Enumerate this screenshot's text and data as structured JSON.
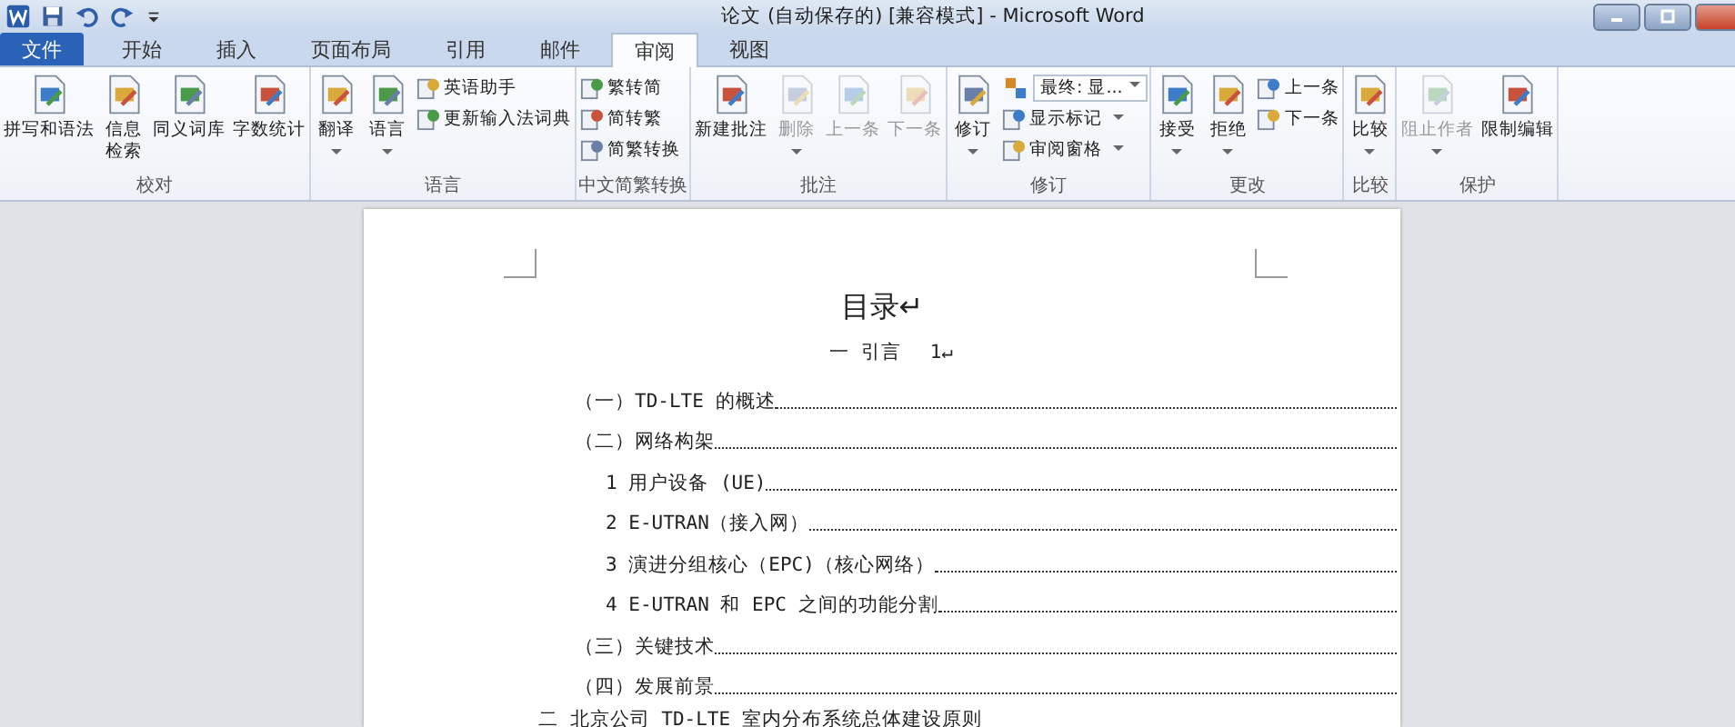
{
  "window": {
    "title": "论文 (自动保存的) [兼容模式] - Microsoft Word"
  },
  "tabs": [
    {
      "label": "文件",
      "kind": "file",
      "selected": false
    },
    {
      "label": "开始",
      "kind": "tab",
      "selected": false
    },
    {
      "label": "插入",
      "kind": "tab",
      "selected": false
    },
    {
      "label": "页面布局",
      "kind": "tab",
      "selected": false
    },
    {
      "label": "引用",
      "kind": "tab",
      "selected": false
    },
    {
      "label": "邮件",
      "kind": "tab",
      "selected": false
    },
    {
      "label": "审阅",
      "kind": "tab",
      "selected": true
    },
    {
      "label": "视图",
      "kind": "tab",
      "selected": false
    }
  ],
  "ribbon": {
    "groups": [
      {
        "label": "校对",
        "controls": [
          {
            "kind": "large",
            "label": "拼写和语法",
            "disabled": false,
            "has_menu": false
          },
          {
            "kind": "large",
            "label": "信息检索",
            "wrap": true,
            "disabled": false,
            "has_menu": false
          },
          {
            "kind": "large",
            "label": "同义词库",
            "disabled": false,
            "has_menu": false
          },
          {
            "kind": "large",
            "label": "字数统计",
            "disabled": false,
            "has_menu": false
          }
        ]
      },
      {
        "label": "语言",
        "controls": [
          {
            "kind": "large",
            "label": "翻译",
            "disabled": false,
            "has_menu": true
          },
          {
            "kind": "large",
            "label": "语言",
            "disabled": false,
            "has_menu": true
          },
          {
            "kind": "stack",
            "items": [
              {
                "kind": "small",
                "label": "英语助手",
                "disabled": false,
                "has_menu": false
              },
              {
                "kind": "small",
                "label": "更新输入法词典",
                "disabled": false,
                "has_menu": false
              }
            ]
          }
        ]
      },
      {
        "label": "中文简繁转换",
        "controls": [
          {
            "kind": "stack",
            "items": [
              {
                "kind": "small",
                "label": "繁转简",
                "disabled": false,
                "has_menu": false
              },
              {
                "kind": "small",
                "label": "简转繁",
                "disabled": false,
                "has_menu": false
              },
              {
                "kind": "small",
                "label": "简繁转换",
                "disabled": false,
                "has_menu": false
              }
            ]
          }
        ]
      },
      {
        "label": "批注",
        "controls": [
          {
            "kind": "large",
            "label": "新建批注",
            "disabled": false,
            "has_menu": false
          },
          {
            "kind": "large",
            "label": "删除",
            "disabled": true,
            "has_menu": true
          },
          {
            "kind": "large",
            "label": "上一条",
            "disabled": true,
            "has_menu": false
          },
          {
            "kind": "large",
            "label": "下一条",
            "disabled": true,
            "has_menu": false
          }
        ]
      },
      {
        "label": "修订",
        "controls": [
          {
            "kind": "large",
            "label": "修订",
            "disabled": false,
            "has_menu": true
          },
          {
            "kind": "stack",
            "items": [
              {
                "kind": "combo",
                "label": "最终: 显...",
                "disabled": false,
                "has_menu": true
              },
              {
                "kind": "small",
                "label": "显示标记",
                "disabled": false,
                "has_menu": true
              },
              {
                "kind": "small",
                "label": "审阅窗格",
                "disabled": false,
                "has_menu": true
              }
            ]
          }
        ]
      },
      {
        "label": "更改",
        "controls": [
          {
            "kind": "large",
            "label": "接受",
            "disabled": false,
            "has_menu": true
          },
          {
            "kind": "large",
            "label": "拒绝",
            "disabled": false,
            "has_menu": true
          },
          {
            "kind": "stack",
            "items": [
              {
                "kind": "small",
                "label": "上一条",
                "disabled": false,
                "has_menu": false
              },
              {
                "kind": "small",
                "label": "下一条",
                "disabled": false,
                "has_menu": false
              }
            ]
          }
        ]
      },
      {
        "label": "比较",
        "controls": [
          {
            "kind": "large",
            "label": "比较",
            "disabled": false,
            "has_menu": true
          }
        ]
      },
      {
        "label": "保护",
        "controls": [
          {
            "kind": "large",
            "label": "阻止作者",
            "disabled": true,
            "has_menu": true
          },
          {
            "kind": "large",
            "label": "限制编辑",
            "disabled": false,
            "has_menu": false
          }
        ]
      }
    ]
  },
  "document": {
    "heading": "目录↵",
    "sections": [
      {
        "kind": "centered",
        "title": "一  引言",
        "page": "1↵",
        "children": [
          {
            "title": "（一）TD-LTE 的概述"
          },
          {
            "title": "（二）网络构架",
            "children": [
              {
                "title": "1 用户设备 (UE)"
              },
              {
                "title": "2  E-UTRAN（接入网）"
              },
              {
                "title": "3 演进分组核心（EPC)（核心网络）"
              },
              {
                "title": "4 E-UTRAN 和 EPC 之间的功能分割"
              }
            ]
          },
          {
            "title": "（三）关键技术"
          },
          {
            "title": "（四）发展前景"
          }
        ]
      },
      {
        "kind": "plain",
        "title": "二 北京公司 TD-LTE 室内分布系统总体建设原则"
      }
    ]
  }
}
